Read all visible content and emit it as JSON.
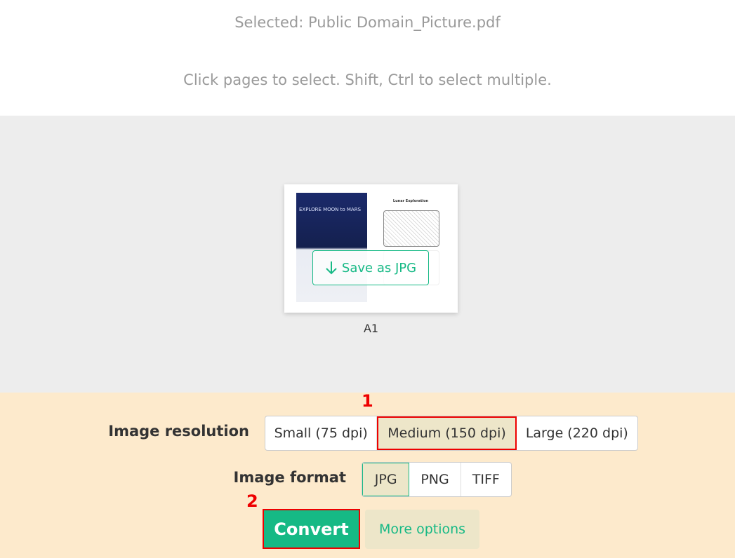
{
  "header": {
    "selected_text": "Selected: Public Domain_Picture.pdf",
    "instructions": "Click pages to select. Shift, Ctrl to select multiple."
  },
  "page": {
    "label": "A1",
    "save_button": "Save as JPG",
    "thumb_left_title": "EXPLORE MOON to MARS",
    "thumb_right_title": "Lunar Exploration"
  },
  "options": {
    "resolution_label": "Image resolution",
    "resolutions": [
      {
        "label": "Small (75 dpi)",
        "selected": false
      },
      {
        "label": "Medium (150 dpi)",
        "selected": true
      },
      {
        "label": "Large (220 dpi)",
        "selected": false
      }
    ],
    "format_label": "Image format",
    "formats": [
      {
        "label": "JPG",
        "selected": true
      },
      {
        "label": "PNG",
        "selected": false
      },
      {
        "label": "TIFF",
        "selected": false
      }
    ],
    "convert": "Convert",
    "more": "More options"
  },
  "annotations": {
    "step1": "1",
    "step2": "2",
    "highlight_color": "#e00000"
  },
  "colors": {
    "accent": "#16b985",
    "panel": "#fdeacc",
    "selected": "#ede6c9"
  }
}
